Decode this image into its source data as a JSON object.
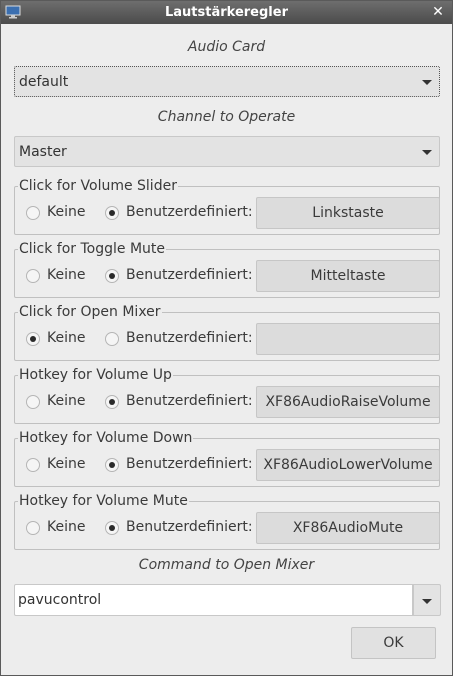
{
  "window": {
    "title": "Lautstärkeregler",
    "icon": "monitor-icon",
    "close_icon": "close-icon"
  },
  "audio_card": {
    "label": "Audio Card",
    "value": "default"
  },
  "channel": {
    "label": "Channel to Operate",
    "value": "Master"
  },
  "groups": [
    {
      "title": "Click for Volume Slider",
      "opt1": "Keine",
      "opt2": "Benutzerdefiniert:",
      "selected": "custom",
      "key": "Linkstaste"
    },
    {
      "title": "Click for Toggle Mute",
      "opt1": "Keine",
      "opt2": "Benutzerdefiniert:",
      "selected": "custom",
      "key": "Mitteltaste"
    },
    {
      "title": "Click for Open Mixer",
      "opt1": "Keine",
      "opt2": "Benutzerdefiniert:",
      "selected": "none",
      "key": ""
    },
    {
      "title": "Hotkey for Volume Up",
      "opt1": "Keine",
      "opt2": "Benutzerdefiniert:",
      "selected": "custom",
      "key": "XF86AudioRaiseVolume"
    },
    {
      "title": "Hotkey for Volume Down",
      "opt1": "Keine",
      "opt2": "Benutzerdefiniert:",
      "selected": "custom",
      "key": "XF86AudioLowerVolume"
    },
    {
      "title": "Hotkey for Volume Mute",
      "opt1": "Keine",
      "opt2": "Benutzerdefiniert:",
      "selected": "custom",
      "key": "XF86AudioMute"
    }
  ],
  "mixer": {
    "label": "Command to Open Mixer",
    "value": "pavucontrol"
  },
  "ok_label": "OK"
}
